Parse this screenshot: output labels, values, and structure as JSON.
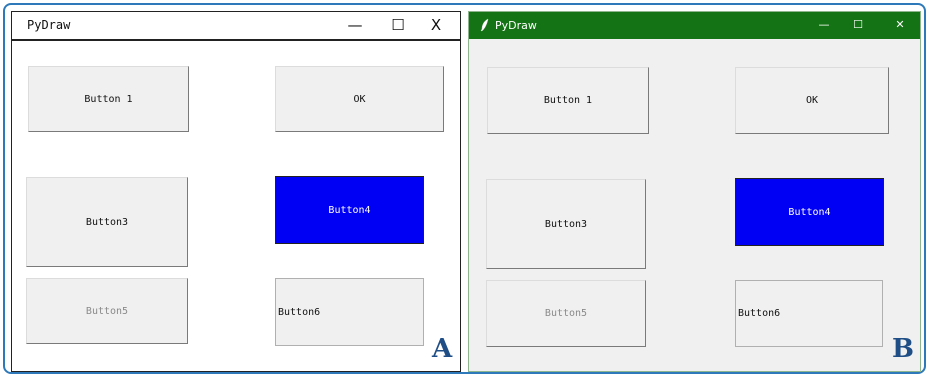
{
  "windows": [
    {
      "title": "PyDraw",
      "controls": {
        "minimize": "—",
        "maximize": "☐",
        "close": "X"
      },
      "buttons": {
        "button1": "Button 1",
        "ok": "OK",
        "button3": "Button3",
        "button4": "Button4",
        "button5": "Button5",
        "button6": "Button6"
      },
      "label": "A"
    },
    {
      "title": "PyDraw",
      "controls": {
        "minimize": "—",
        "maximize": "☐",
        "close": "✕"
      },
      "buttons": {
        "button1": "Button 1",
        "ok": "OK",
        "button3": "Button3",
        "button4": "Button4",
        "button5": "Button5",
        "button6": "Button6"
      },
      "label": "B"
    }
  ],
  "colors": {
    "frame_border": "#2e79b9",
    "titlebar_b": "#147314",
    "button4_bg": "#0000f5",
    "label_color": "#1f4e86"
  },
  "icons": {
    "app_icon_b": "feather-icon"
  }
}
